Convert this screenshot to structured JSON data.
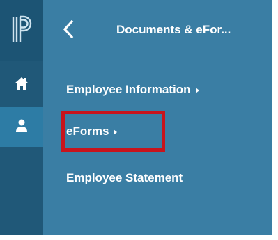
{
  "rail": {
    "logo_icon": "powerschool-logo-icon",
    "home_icon": "home-icon",
    "user_icon": "user-icon"
  },
  "header": {
    "back_icon": "chevron-left-icon",
    "title": "Documents & eFor..."
  },
  "menu": {
    "items": [
      {
        "label": "Employee Information",
        "has_submenu": true
      },
      {
        "label": "eForms",
        "has_submenu": true
      },
      {
        "label": "Employee Statement",
        "has_submenu": false
      }
    ]
  },
  "colors": {
    "rail": "#205878",
    "rail_active": "#2d7ca5",
    "panel": "#3a7ea4",
    "text": "#ffffff",
    "highlight": "#c8141c"
  }
}
